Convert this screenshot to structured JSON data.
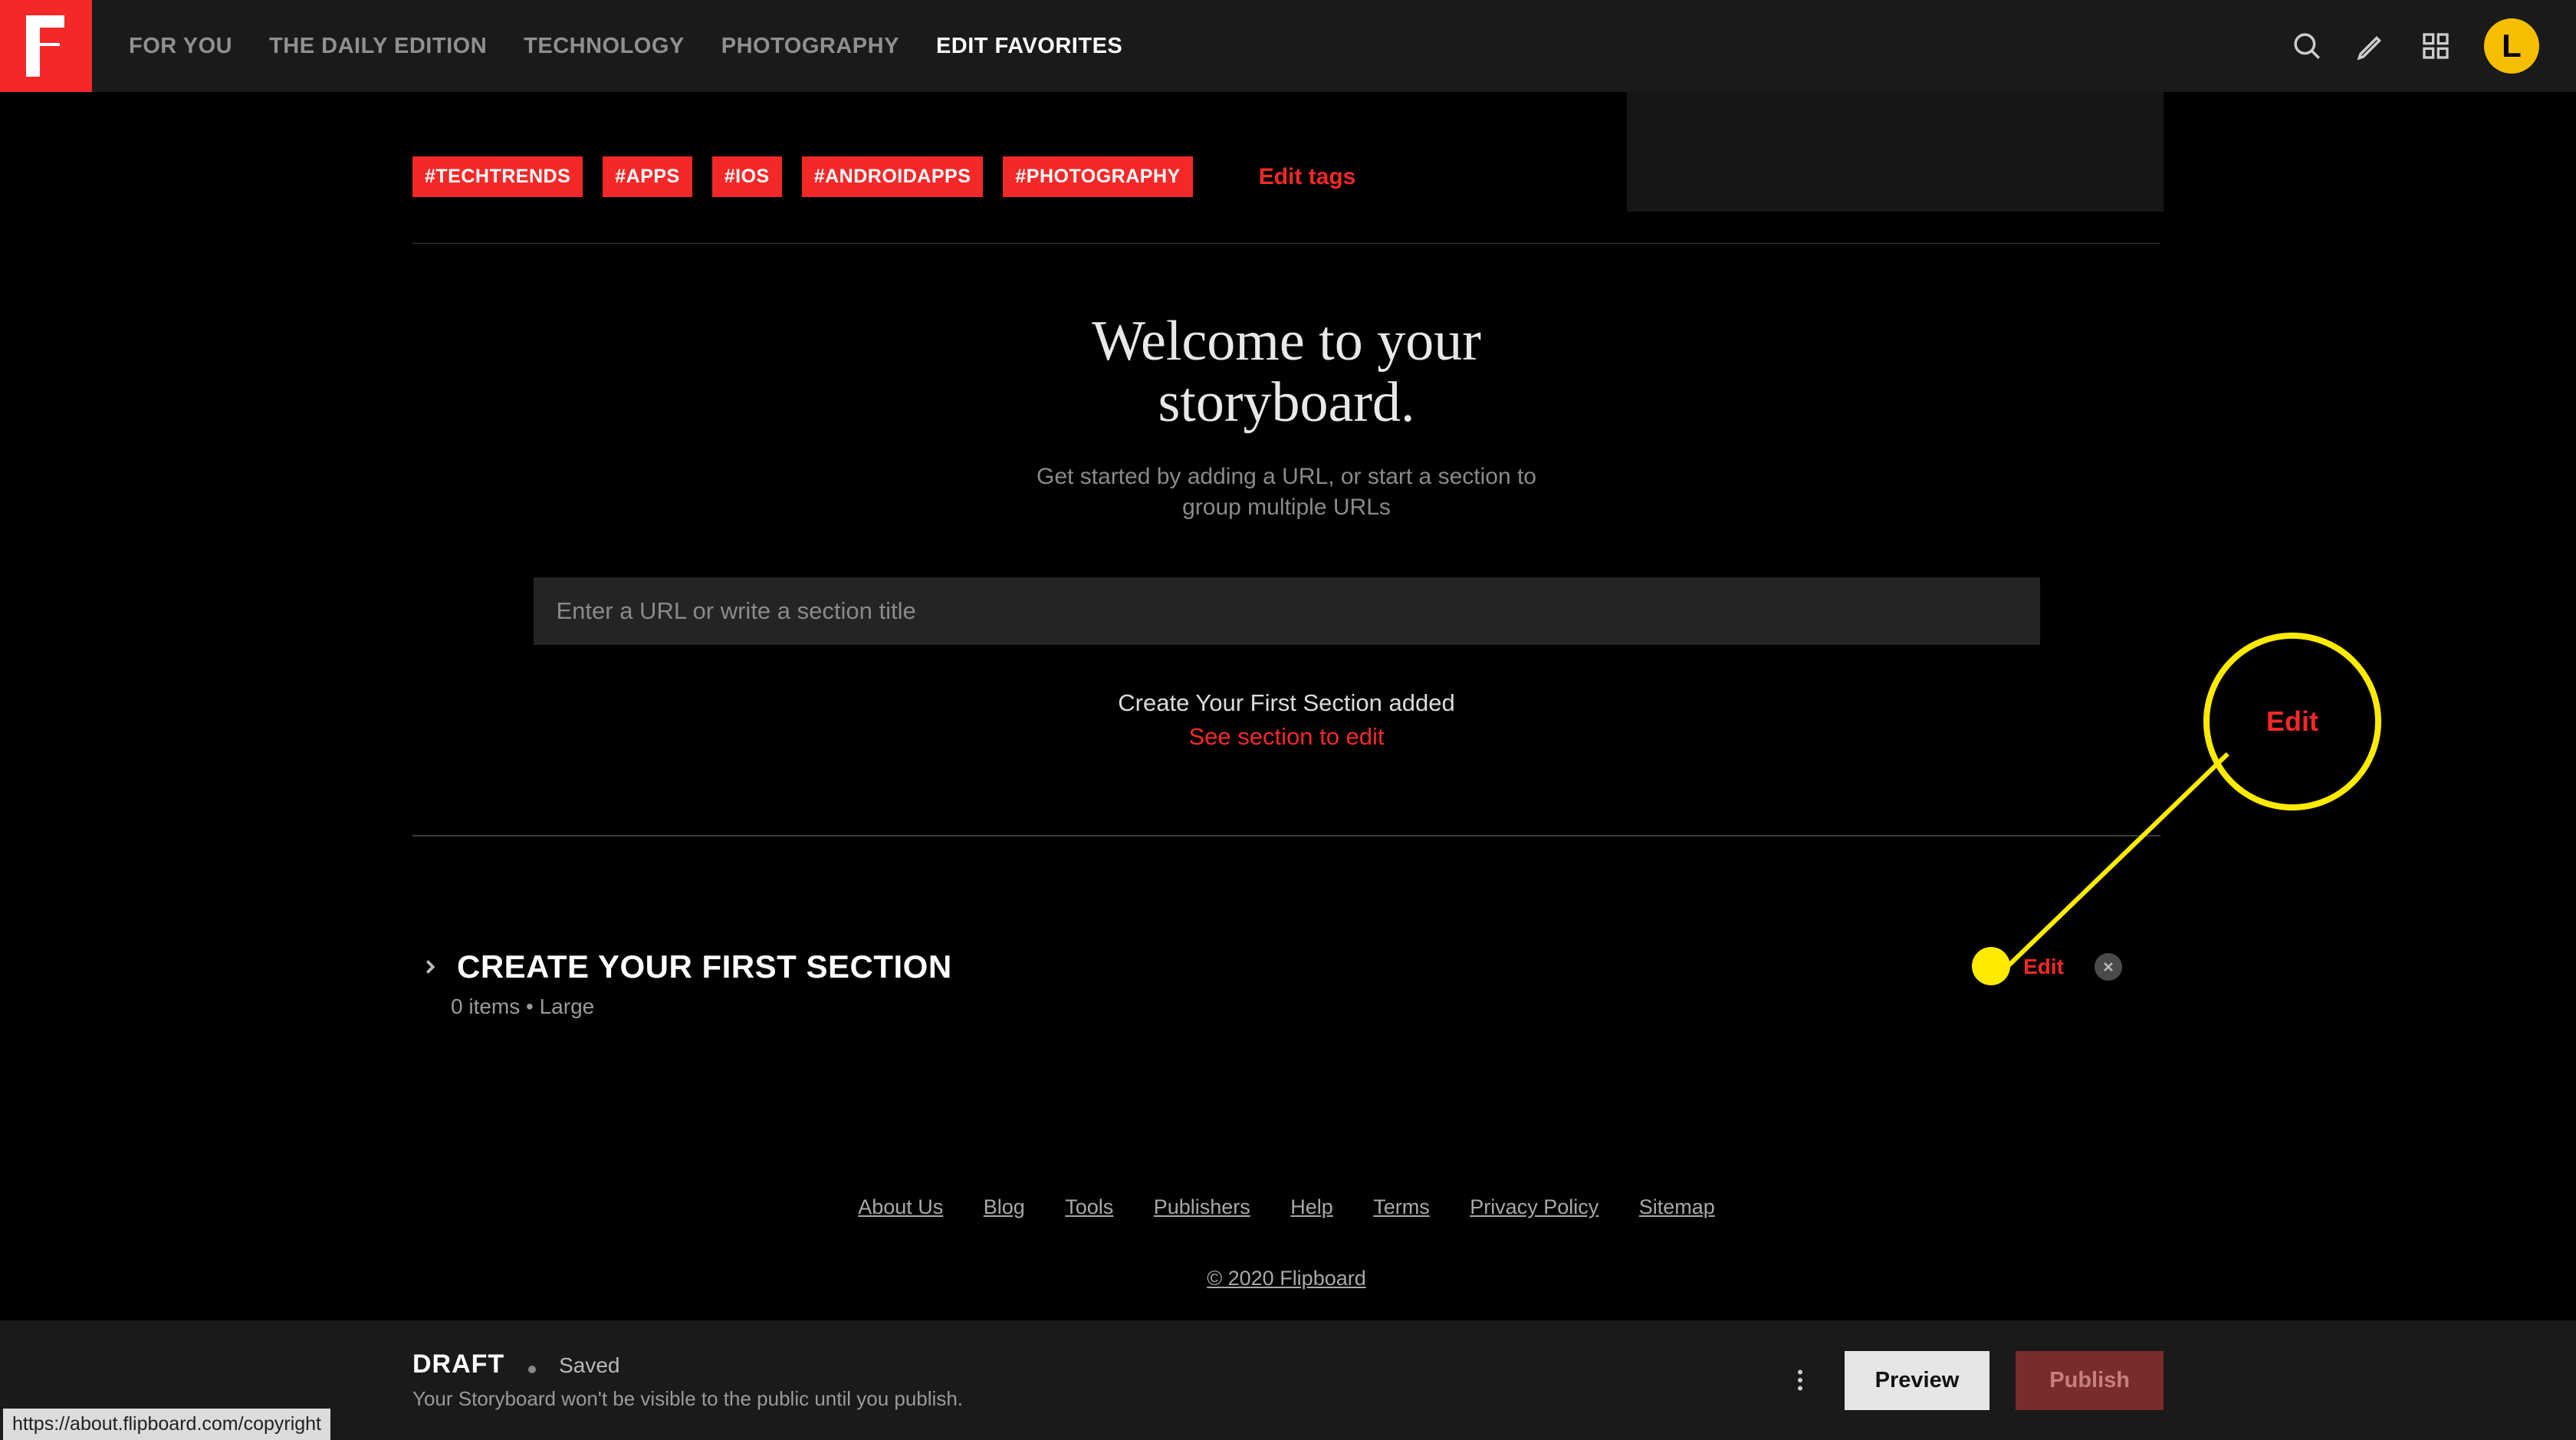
{
  "header": {
    "nav": [
      {
        "label": "FOR YOU",
        "active": false
      },
      {
        "label": "THE DAILY EDITION",
        "active": false
      },
      {
        "label": "TECHNOLOGY",
        "active": false
      },
      {
        "label": "PHOTOGRAPHY",
        "active": false
      },
      {
        "label": "EDIT FAVORITES",
        "active": true
      }
    ],
    "avatar_initial": "L"
  },
  "tags": [
    "#TECHTRENDS",
    "#APPS",
    "#IOS",
    "#ANDROIDAPPS",
    "#PHOTOGRAPHY"
  ],
  "edit_tags_label": "Edit tags",
  "welcome": {
    "title_line1": "Welcome to your",
    "title_line2": "storyboard.",
    "subtitle_line1": "Get started by adding a URL, or start a section to",
    "subtitle_line2": "group multiple URLs"
  },
  "url_input_placeholder": "Enter a URL or write a section title",
  "added": {
    "line1": "Create Your First Section added",
    "line2": "See section to edit"
  },
  "section": {
    "title": "CREATE YOUR FIRST SECTION",
    "meta": "0 items • Large",
    "edit_label": "Edit"
  },
  "footer_links": [
    "About Us",
    "Blog",
    "Tools",
    "Publishers",
    "Help",
    "Terms",
    "Privacy Policy",
    "Sitemap"
  ],
  "copyright": "© 2020 Flipboard",
  "bottom_bar": {
    "draft": "DRAFT",
    "saved": "Saved",
    "subtitle": "Your Storyboard won't be visible to the public until you publish.",
    "preview": "Preview",
    "publish": "Publish"
  },
  "status_url": "https://about.flipboard.com/copyright",
  "annotation": {
    "label": "Edit"
  }
}
